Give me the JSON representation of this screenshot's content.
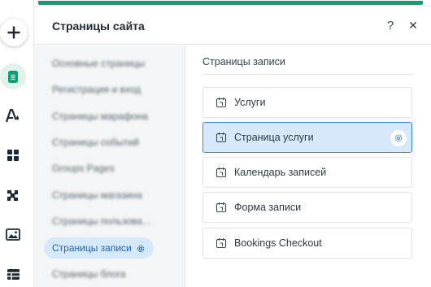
{
  "panel": {
    "title": "Страницы сайта",
    "help_label": "?",
    "close_label": "✕"
  },
  "categories": [
    {
      "label": "Основные страницы",
      "blurred": true
    },
    {
      "label": "Регистрация и вход",
      "blurred": true
    },
    {
      "label": "Страницы марафона",
      "blurred": true
    },
    {
      "label": "Страницы событий",
      "blurred": true
    },
    {
      "label": "Groups Pages",
      "blurred": true
    },
    {
      "label": "Страницы магазина",
      "blurred": true
    },
    {
      "label": "Страницы пользова…",
      "blurred": true
    },
    {
      "label": "Страницы записи",
      "blurred": false,
      "active": true
    },
    {
      "label": "Страницы блога",
      "blurred": true
    }
  ],
  "section": {
    "title": "Страницы записи",
    "pages": [
      {
        "label": "Услуги",
        "icon": "calendar-page-icon"
      },
      {
        "label": "Страница услуги",
        "icon": "calendar-page-icon",
        "selected": true
      },
      {
        "label": "Календарь записей",
        "icon": "calendar-page-icon"
      },
      {
        "label": "Форма записи",
        "icon": "calendar-page-icon"
      },
      {
        "label": "Bookings Checkout",
        "icon": "calendar-page-icon"
      }
    ]
  },
  "toolbar": {
    "items": [
      "add-icon",
      "pages-icon",
      "design-icon",
      "apps-icon",
      "plugins-icon",
      "media-icon",
      "table-icon"
    ]
  },
  "colors": {
    "accent_green": "#0f9d74",
    "selection_blue": "#3a86eb",
    "selection_bg": "#d7e8fc"
  }
}
